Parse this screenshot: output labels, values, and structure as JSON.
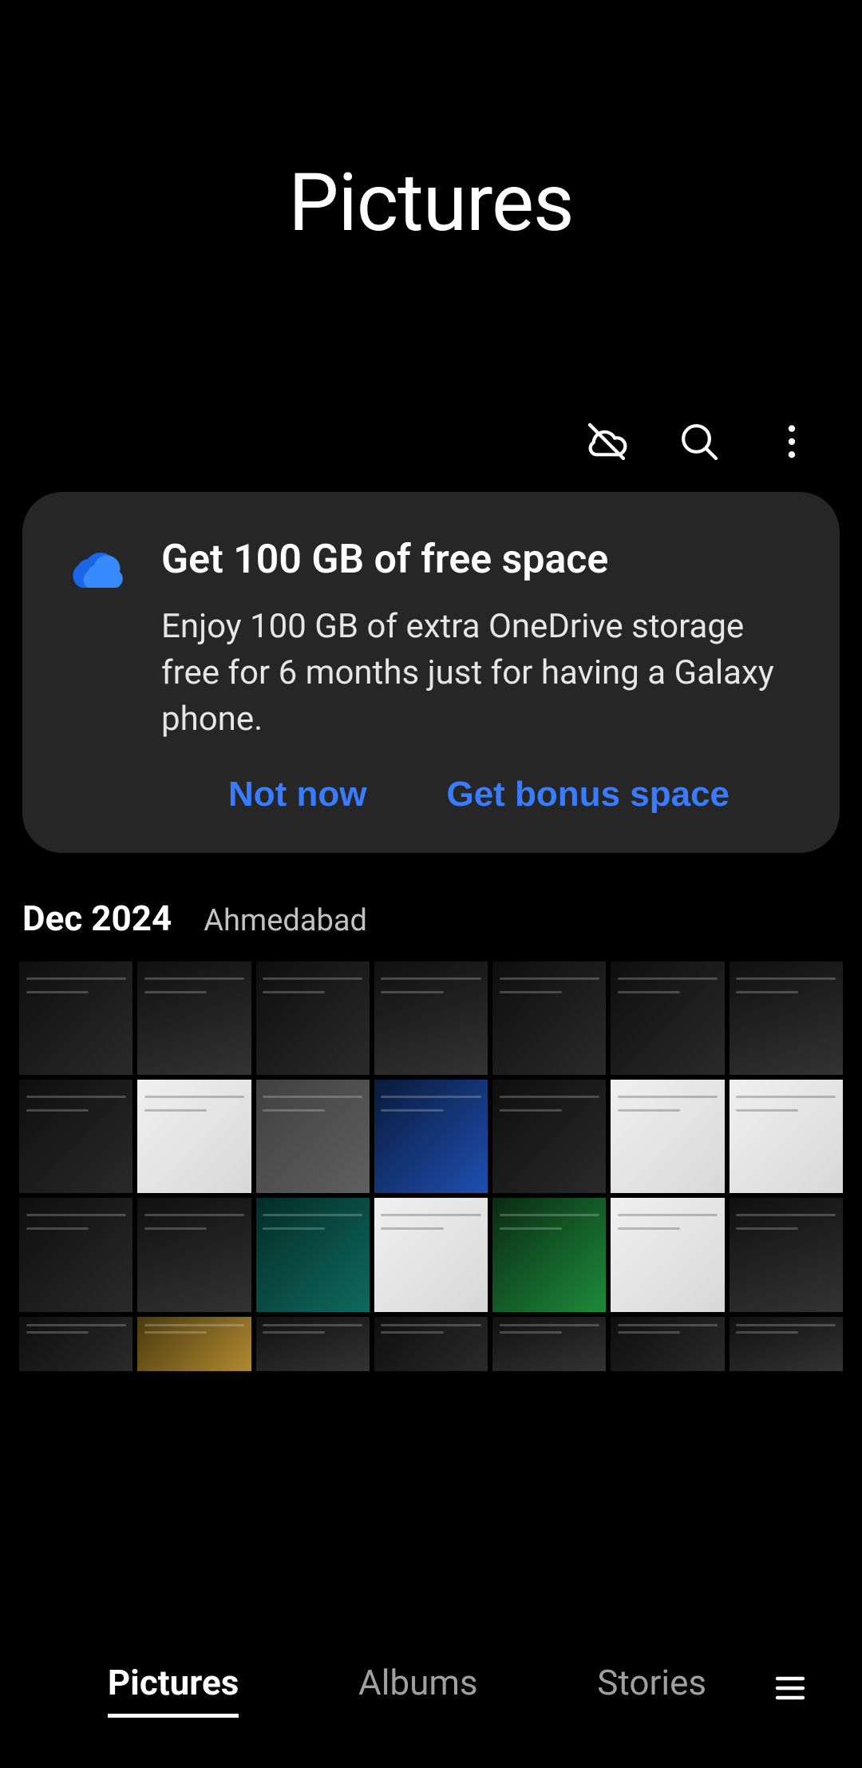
{
  "header": {
    "title": "Pictures"
  },
  "actions": {
    "sync_off": "cloud-sync-off-icon",
    "search": "search-icon",
    "more": "more-options-icon"
  },
  "promo": {
    "icon": "onedrive-cloud-icon",
    "title": "Get 100 GB of free space",
    "description": "Enjoy 100 GB of extra OneDrive storage free for 6 months just for having a Galaxy phone.",
    "not_now": "Not now",
    "get_bonus": "Get bonus space"
  },
  "section": {
    "date": "Dec 2024",
    "location": "Ahmedabad"
  },
  "thumbnails": [
    {
      "style": "t-dark"
    },
    {
      "style": "t-dark2"
    },
    {
      "style": "t-dark"
    },
    {
      "style": "t-dark2"
    },
    {
      "style": "t-dark"
    },
    {
      "style": "t-dark"
    },
    {
      "style": "t-dark2"
    },
    {
      "style": "t-dark"
    },
    {
      "style": "t-white"
    },
    {
      "style": "t-gray"
    },
    {
      "style": "t-blue"
    },
    {
      "style": "t-dark"
    },
    {
      "style": "t-white"
    },
    {
      "style": "t-white"
    },
    {
      "style": "t-dark"
    },
    {
      "style": "t-dark2"
    },
    {
      "style": "t-teal"
    },
    {
      "style": "t-white"
    },
    {
      "style": "t-green"
    },
    {
      "style": "t-white"
    },
    {
      "style": "t-dark2"
    },
    {
      "style": "t-dark",
      "short": true
    },
    {
      "style": "t-warm",
      "short": true
    },
    {
      "style": "t-dark2",
      "short": true
    },
    {
      "style": "t-dark",
      "short": true
    },
    {
      "style": "t-dark2",
      "short": true
    },
    {
      "style": "t-dark",
      "short": true
    },
    {
      "style": "t-dark2",
      "short": true
    }
  ],
  "nav": {
    "tabs": [
      {
        "label": "Pictures",
        "active": true
      },
      {
        "label": "Albums",
        "active": false
      },
      {
        "label": "Stories",
        "active": false
      }
    ],
    "menu": "hamburger-menu-icon"
  }
}
